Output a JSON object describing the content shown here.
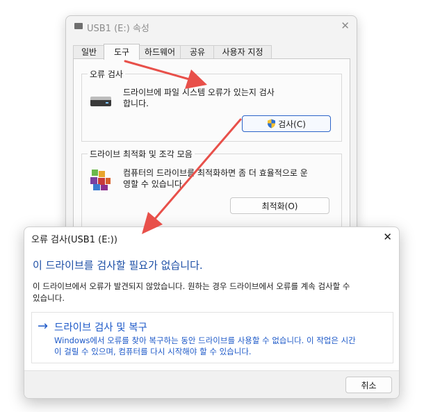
{
  "properties": {
    "title": "USB1 (E:) 속성",
    "tabs": [
      {
        "label": "일반"
      },
      {
        "label": "도구"
      },
      {
        "label": "하드웨어"
      },
      {
        "label": "공유"
      },
      {
        "label": "사용자 지정"
      }
    ],
    "active_tab": "도구",
    "error_check": {
      "group_label": "오류 검사",
      "description_line1": "드라이브에 파일 시스템 오류가 있는지 검사",
      "description_line2": "합니다.",
      "button_label": "검사(C)"
    },
    "optimize": {
      "group_label": "드라이브 최적화 및 조각 모음",
      "description_line1": "컴퓨터의 드라이브를 최적화하면 좀 더 효율적으로 운",
      "description_line2": "영할 수 있습니다.",
      "button_label": "최적화(O)"
    }
  },
  "error_dialog": {
    "title": "오류 검사(USB1 (E:))",
    "heading": "이 드라이브를 검사할 필요가 없습니다.",
    "description_line1": "이 드라이브에서 오류가 발견되지 않았습니다. 원하는 경우 드라이브에서 오류를 계속 검사할 수",
    "description_line2": "있습니다.",
    "link": {
      "arrow": "→",
      "title": "드라이브 검사 및 복구",
      "description_line1": "Windows에서 오류를 찾아 복구하는 동안 드라이브를 사용할 수 없습니다. 이 작업은 시간",
      "description_line2": "이 걸릴 수 있으며, 컴퓨터를 다시 시작해야 할 수 있습니다."
    },
    "cancel_label": "취소"
  },
  "colors": {
    "annotation_arrow": "#e8504a",
    "link_blue": "#1d59c8",
    "heading_blue": "#1d4fa6",
    "accent_border": "#2c64c8"
  },
  "icons": [
    "drive-icon",
    "close-icon",
    "hard-drive-icon",
    "uac-shield-icon",
    "defrag-icon",
    "arrow-right-icon"
  ]
}
